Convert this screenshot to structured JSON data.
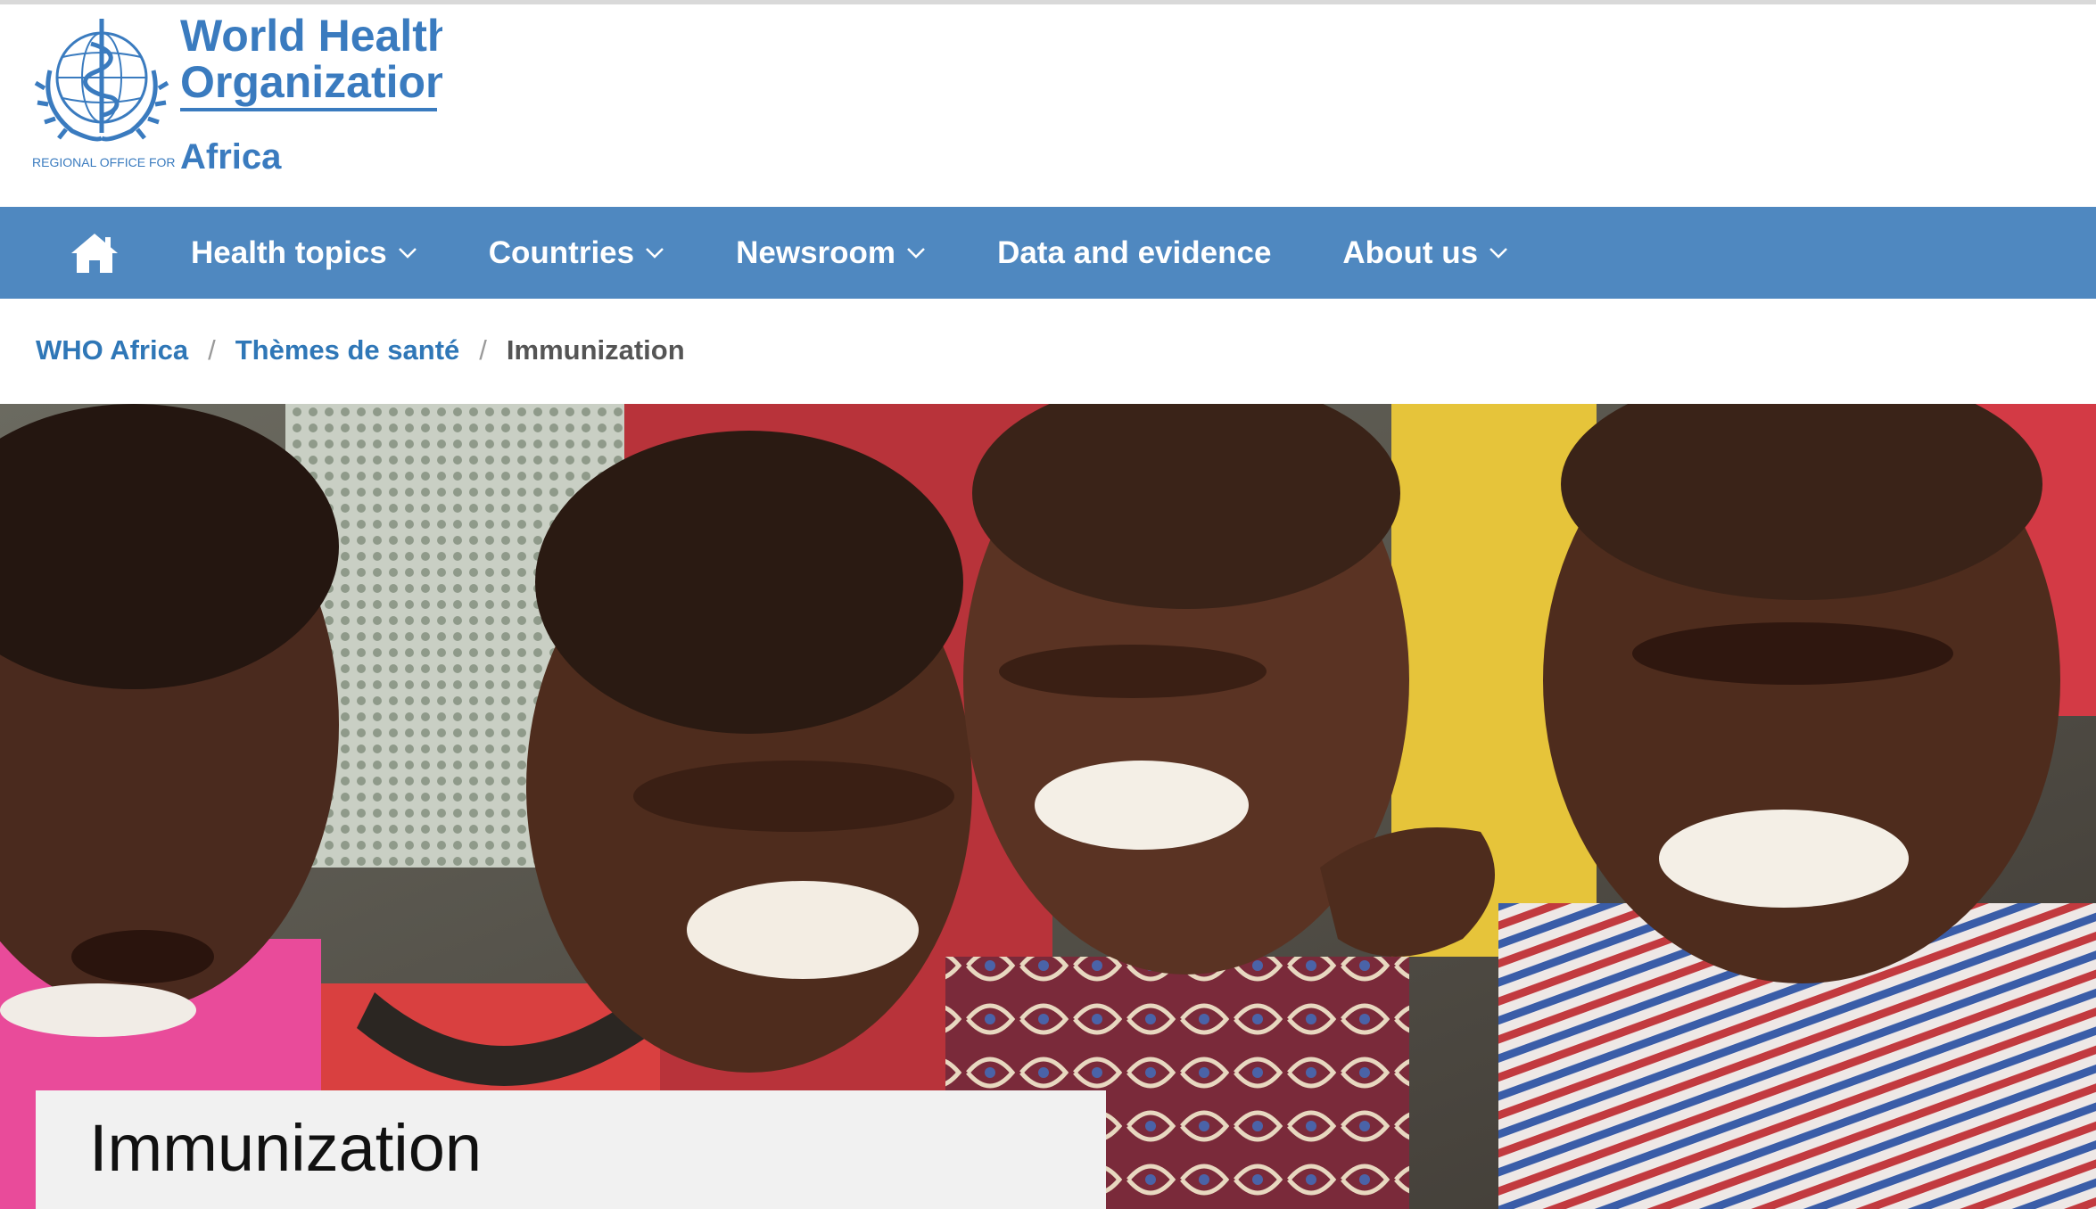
{
  "logo": {
    "line1": "World Health",
    "line2": "Organization",
    "region_prefix": "REGIONAL OFFICE FOR",
    "region": "Africa",
    "emblem_icon": "who-emblem-icon"
  },
  "nav": {
    "home_icon": "home-icon",
    "items": [
      {
        "label": "Health topics",
        "has_dropdown": true
      },
      {
        "label": "Countries",
        "has_dropdown": true
      },
      {
        "label": "Newsroom",
        "has_dropdown": true
      },
      {
        "label": "Data and evidence",
        "has_dropdown": false
      },
      {
        "label": "About us",
        "has_dropdown": true
      }
    ]
  },
  "breadcrumb": {
    "items": [
      "WHO Africa",
      "Thèmes de santé"
    ],
    "separator": "/",
    "current": "Immunization"
  },
  "hero": {
    "title": "Immunization"
  },
  "colors": {
    "brand_blue": "#4f88c0",
    "link_blue": "#2f77b7",
    "logo_blue": "#3a7bbf",
    "title_box_bg": "#f1f1f1"
  }
}
